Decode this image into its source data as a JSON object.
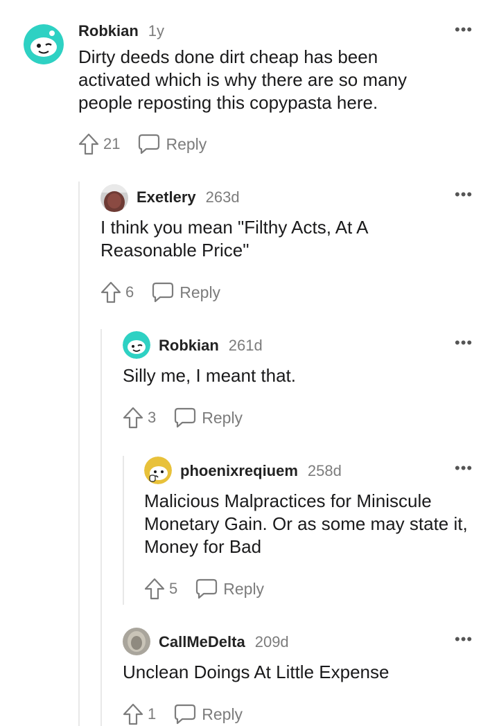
{
  "comments": [
    {
      "user": "Robkian",
      "age": "1y",
      "text": "Dirty deeds done dirt cheap has been activated which is why there are so many people reposting this copypasta here.",
      "votes": "21",
      "reply": "Reply",
      "more": "•••",
      "avatar_icon": "snoo-avatar-teal"
    },
    {
      "user": "Exetlery",
      "age": "263d",
      "text": "I think you mean \"Filthy Acts, At A Reasonable Price\"",
      "votes": "6",
      "reply": "Reply",
      "more": "•••",
      "avatar_icon": "photo-avatar-face"
    },
    {
      "user": "Robkian",
      "age": "261d",
      "text": "Silly me, I meant that.",
      "votes": "3",
      "reply": "Reply",
      "more": "•••",
      "avatar_icon": "snoo-avatar-teal"
    },
    {
      "user": "phoenixreqiuem",
      "age": "258d",
      "text": "Malicious Malpractices for Miniscule Monetary Gain. Or as some may state it, Money for Bad",
      "votes": "5",
      "reply": "Reply",
      "more": "•••",
      "avatar_icon": "snoo-avatar-yellow"
    },
    {
      "user": "CallMeDelta",
      "age": "209d",
      "text": "Unclean Doings At Little Expense",
      "votes": "1",
      "reply": "Reply",
      "more": "•••",
      "avatar_icon": "photo-avatar-grey"
    }
  ],
  "colors": {
    "teal": "#2ed1c3",
    "yellow": "#e8c13a",
    "text": "#1a1a1b",
    "muted": "#7c7c7c",
    "thread": "#e8e8e8"
  }
}
